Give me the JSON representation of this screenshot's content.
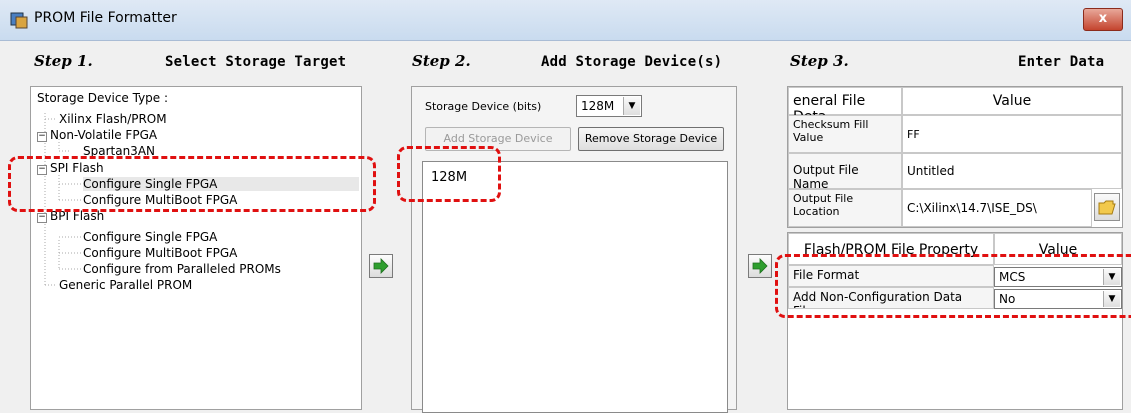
{
  "window": {
    "title": "PROM File Formatter",
    "close_label": "x"
  },
  "step1": {
    "step_label": "Step 1.",
    "title": "Select Storage Target",
    "tree_header": "Storage Device Type :",
    "tree": [
      {
        "label": "Xilinx Flash/PROM"
      },
      {
        "label": "Non-Volatile FPGA",
        "exp": "−"
      },
      {
        "label": "Spartan3AN"
      },
      {
        "label": "SPI Flash",
        "exp": "−"
      },
      {
        "label": "Configure Single FPGA"
      },
      {
        "label": "Configure MultiBoot FPGA"
      },
      {
        "label": "BPI Flash",
        "exp": "−"
      },
      {
        "label": "Configure Single FPGA"
      },
      {
        "label": "Configure MultiBoot FPGA"
      },
      {
        "label": "Configure from Paralleled PROMs"
      },
      {
        "label": "Generic Parallel PROM"
      }
    ]
  },
  "step2": {
    "step_label": "Step 2.",
    "title": "Add Storage Device(s)",
    "size_label": "Storage Device (bits)",
    "size_value": "128M",
    "add_label": "Add Storage Device",
    "remove_label": "Remove Storage Device",
    "devices": [
      "128M"
    ]
  },
  "step3": {
    "step_label": "Step 3.",
    "title": "Enter Data",
    "general_header": "eneral File Deta",
    "value_header": "Value",
    "checksum_label": "Checksum Fill Value",
    "checksum_value": "FF",
    "output_name_label": "Output File Name",
    "output_name_value": "Untitled",
    "output_location_label": "Output File Location",
    "output_location_value": "C:\\Xilinx\\14.7\\ISE_DS\\",
    "flash_header": "Flash/PROM File Property",
    "flash_value_header": "Value",
    "file_format_label": "File Format",
    "file_format_value": "MCS",
    "add_nonconfig_label": "Add Non-Configuration Data Files",
    "add_nonconfig_value": "No"
  },
  "colors": {
    "highlight": "#e01010",
    "arrow": "#2e9e2e"
  }
}
